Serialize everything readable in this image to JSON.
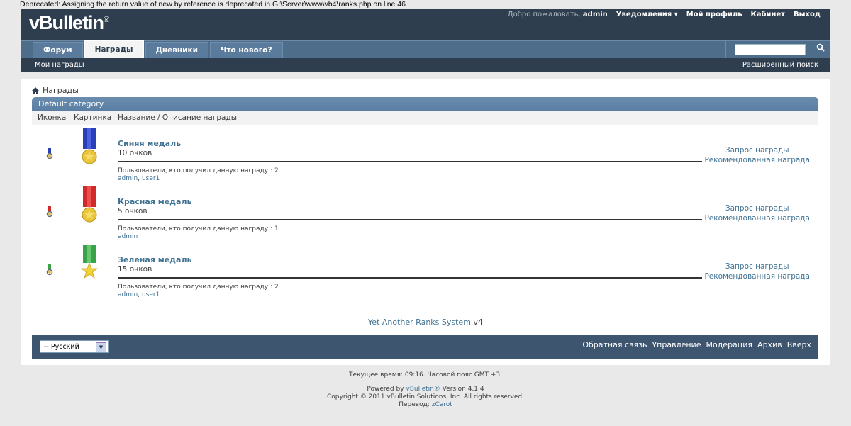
{
  "deprecated_notice": "Deprecated: Assigning the return value of new by reference is deprecated in G:\\Server\\www\\vb4\\ranks.php on line 46",
  "logo": {
    "text": "vBulletin",
    "mark": "®"
  },
  "toplinks": {
    "welcome": "Добро пожаловать,",
    "user": "admin",
    "notifications": "Уведомления",
    "profile": "Мой профиль",
    "cabinet": "Кабинет",
    "logout": "Выход"
  },
  "tabs": [
    {
      "label": "Форум"
    },
    {
      "label": "Награды"
    },
    {
      "label": "Дневники"
    },
    {
      "label": "Что нового?"
    }
  ],
  "subnav": {
    "left": "Мои награды",
    "right": "Расширенный поиск"
  },
  "breadcrumb": {
    "label": "Награды"
  },
  "category": {
    "title": "Default category"
  },
  "columns": {
    "icon": "Иконка",
    "picture": "Картинка",
    "name": "Название / Описание награды"
  },
  "awards": [
    {
      "title": "Синяя медаль",
      "points": "10 очков",
      "users_label": "Пользователи, кто получил данную награду:: 2",
      "users": [
        "admin",
        "user1"
      ],
      "ribbon": "#2a3fb8",
      "medal": "#e8c53a"
    },
    {
      "title": "Красная медаль",
      "points": "5 очков",
      "users_label": "Пользователи, кто получил данную награду:: 1",
      "users": [
        "admin"
      ],
      "ribbon": "#d02a2a",
      "medal": "#e8c53a"
    },
    {
      "title": "Зеленая медаль",
      "points": "15 очков",
      "users_label": "Пользователи, кто получил данную награду:: 2",
      "users": [
        "admin",
        "user1"
      ],
      "ribbon": "#3aa34a",
      "medal": "#f0d23a"
    }
  ],
  "actions": {
    "request": "Запрос награды",
    "recommend": "Рекомендованная награда"
  },
  "credit": {
    "link": "Yet Another Ranks System",
    "suffix": "v4"
  },
  "footer": {
    "language": "-- Русский",
    "links": [
      "Обратная связь",
      "Управление",
      "Модерация",
      "Архив",
      "Вверх"
    ]
  },
  "bottom": {
    "time": "Текущее время: 09:16. Часовой пояс GMT +3.",
    "powered_prefix": "Powered by",
    "powered_link": "vBulletin®",
    "powered_suffix": "Version 4.1.4",
    "copyright": "Copyright © 2011 vBulletin Solutions, Inc. All rights reserved.",
    "translation_prefix": "Перевод:",
    "translation_link": "zCarot"
  },
  "colors": {
    "header": "#2e3e4e",
    "nav": "#4e6d8b",
    "link": "#417394",
    "footer": "#3e5570"
  }
}
